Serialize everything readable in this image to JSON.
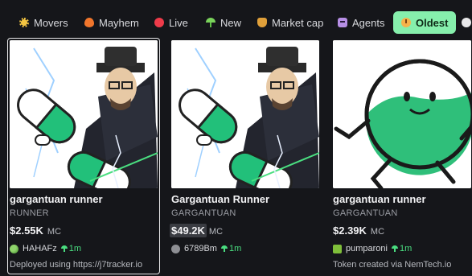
{
  "filters": [
    {
      "label": "Movers",
      "icon": "sun-icon"
    },
    {
      "label": "Mayhem",
      "icon": "flame-icon"
    },
    {
      "label": "Live",
      "icon": "live-dot-icon"
    },
    {
      "label": "New",
      "icon": "sprout-icon"
    },
    {
      "label": "Market cap",
      "icon": "money-bag-icon"
    },
    {
      "label": "Agents",
      "icon": "robot-icon"
    },
    {
      "label": "Oldest",
      "icon": "clock-icon",
      "active": true
    },
    {
      "label": "",
      "icon": "speech-bubble-icon"
    }
  ],
  "colors": {
    "background": "#15161a",
    "active_chip": "#86efac",
    "age_green": "#4ade80",
    "muted_text": "#9a9ca3"
  },
  "cards": [
    {
      "name": "gargantuan runner",
      "ticker": "RUNNER",
      "market_cap": "$2.55K",
      "mc_unit": "MC",
      "creator": "HAHAFz",
      "age": "1m",
      "description": "Deployed using https://j7tracker.io",
      "selected": true
    },
    {
      "name": "Gargantuan Runner",
      "ticker": "GARGANTUAN",
      "market_cap": "$49.2K",
      "mc_unit": "MC",
      "creator": "6789Bm",
      "age": "1m",
      "description": ""
    },
    {
      "name": "gargantuan runner",
      "ticker": "GARGANTUAN",
      "market_cap": "$2.39K",
      "mc_unit": "MC",
      "creator": "pumparoni",
      "age": "1m",
      "description": "Token created via NemTech.io"
    }
  ]
}
